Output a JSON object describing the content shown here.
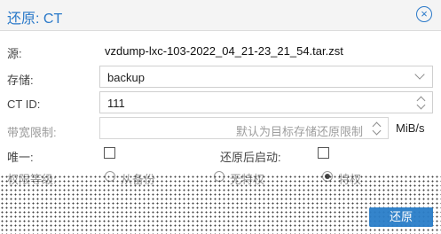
{
  "dialog": {
    "title": "还原: CT",
    "close_label": "⊗"
  },
  "source": {
    "label": "源:",
    "value": "vzdump-lxc-103-2022_04_21-23_21_54.tar.zst"
  },
  "storage": {
    "label": "存储:",
    "value": "backup"
  },
  "ct_id": {
    "label": "CT ID:",
    "value": "111"
  },
  "bandwidth": {
    "label": "带宽限制:",
    "placeholder": "默认为目标存储还原限制",
    "unit": "MiB/s"
  },
  "unique": {
    "label": "唯一:",
    "checked": false
  },
  "start_after": {
    "label": "还原后启动:",
    "checked": false
  },
  "privilege": {
    "label": "权限等级:",
    "options": [
      {
        "label": "从备份",
        "selected": false
      },
      {
        "label": "无特权",
        "selected": false
      },
      {
        "label": "特权",
        "selected": true
      }
    ]
  },
  "footer": {
    "restore_label": "还原"
  },
  "colors": {
    "accent": "#2a79c9",
    "button": "#2a7ec9"
  }
}
